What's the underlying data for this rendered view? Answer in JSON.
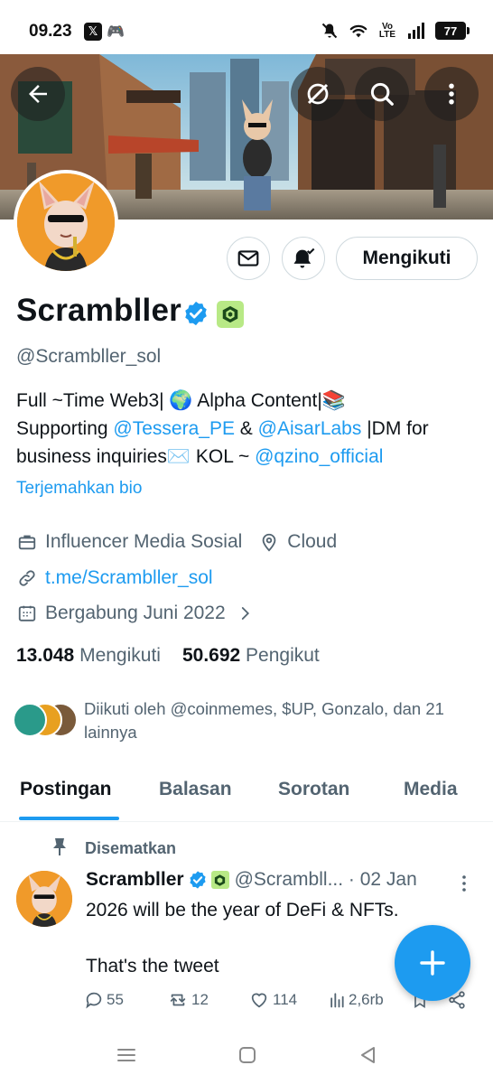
{
  "status_bar": {
    "time": "09.23",
    "volte": "Vo\nLTE",
    "battery": "77"
  },
  "profile": {
    "display_name": "Scrambller",
    "handle": "@Scrambller_sol",
    "follow_label": "Mengikuti",
    "bio": {
      "line1": "Full ~Time Web3| 🌍 Alpha Content|📚",
      "line2_prefix": "Supporting ",
      "mention1": "@Tessera_PE",
      "amp": " & ",
      "mention2": "@AisarLabs",
      "line2_suffix": " |DM for",
      "line3_prefix": "business inquiries✉️ KOL ~ ",
      "mention3": "@qzino_official"
    },
    "translate_label": "Terjemahkan bio",
    "category": "Influencer Media Sosial",
    "location": "Cloud",
    "website": "t.me/Scrambller_sol",
    "joined": "Bergabung Juni 2022",
    "following_count": "13.048",
    "following_label": "Mengikuti",
    "followers_count": "50.692",
    "followers_label": "Pengikut",
    "followed_by": "Diikuti oleh @coinmemes, $UP, Gonzalo, dan 21 lainnya"
  },
  "tabs": [
    "Postingan",
    "Balasan",
    "Sorotan",
    "Media"
  ],
  "pinned_tweet": {
    "pinned_label": "Disematkan",
    "name": "Scrambller",
    "handle_date": "@Scrambll... · 02 Jan",
    "text": "2026 will be the year of DeFi & NFTs.\n\nThat's the tweet",
    "replies": "55",
    "reposts": "12",
    "likes": "114",
    "views": "2,6rb"
  },
  "colors": {
    "accent": "#1d9bf0",
    "text": "#0f1419",
    "muted": "#536471",
    "avatar_bg": "#f09a2a"
  },
  "icons": [
    "back-arrow-icon",
    "grok-icon",
    "search-icon",
    "more-vertical-icon",
    "mail-icon",
    "bell-check-icon",
    "verified-badge-icon",
    "affiliate-badge-icon",
    "briefcase-icon",
    "location-pin-icon",
    "link-icon",
    "calendar-icon",
    "chevron-right-icon",
    "pin-icon",
    "reply-icon",
    "repost-icon",
    "like-icon",
    "views-icon",
    "bookmark-icon",
    "share-icon",
    "compose-plus-icon"
  ]
}
